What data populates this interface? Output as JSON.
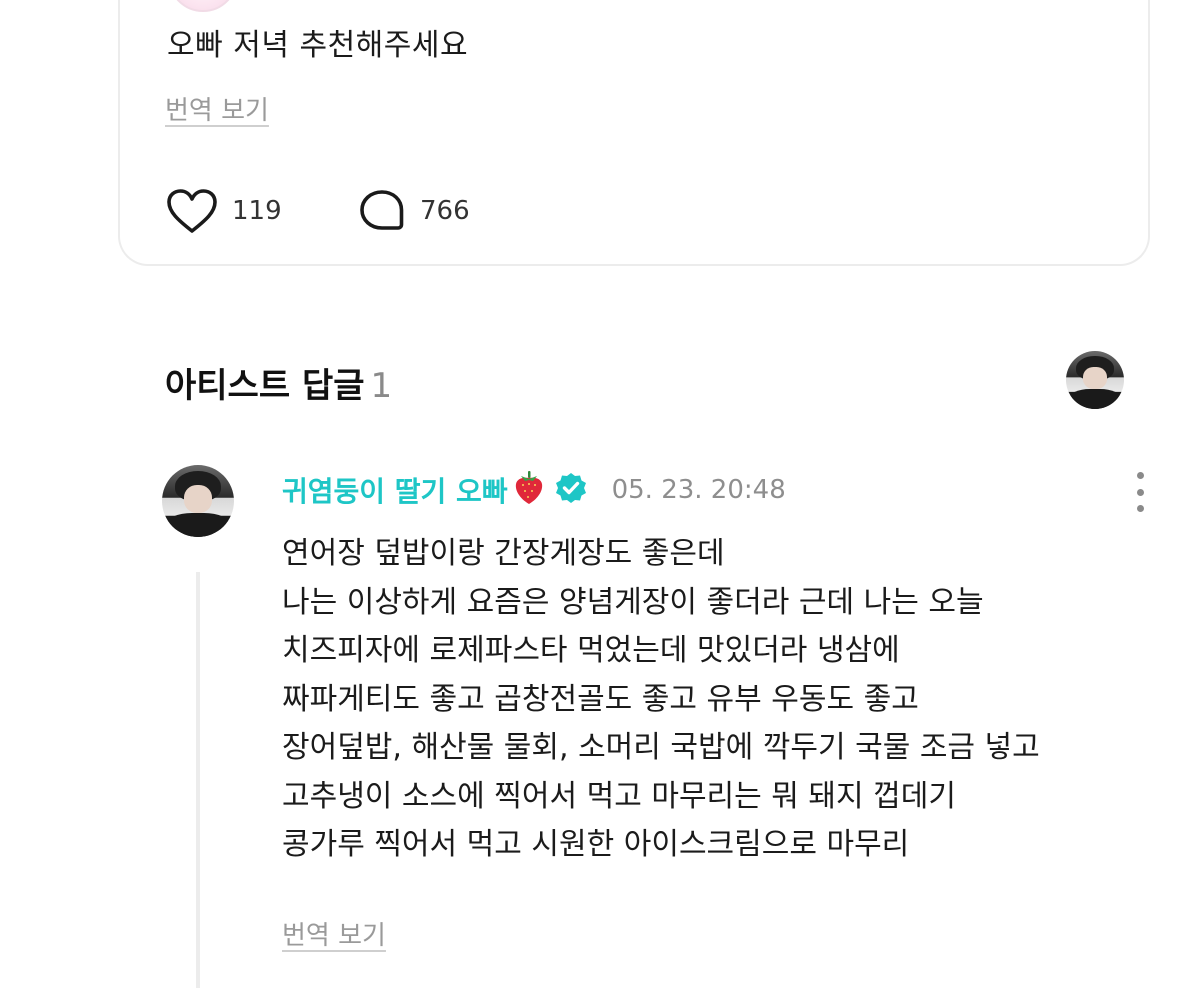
{
  "post": {
    "text": "오빠 저녁 추천해주세요",
    "translate_label": "번역 보기",
    "likes": "119",
    "comments": "766",
    "icons": {
      "like": "heart-outline-icon",
      "comment": "speech-bubble-icon"
    }
  },
  "artist_replies": {
    "title": "아티스트 답글",
    "count": "1"
  },
  "reply": {
    "author": "귀염둥이 딸기 오빠",
    "timestamp": "05. 23. 20:48",
    "lines": [
      "연어장 덮밥이랑 간장게장도 좋은데",
      "나는 이상하게 요즘은 양념게장이 좋더라 근데 나는 오늘",
      "치즈피자에 로제파스타 먹었는데 맛있더라 냉삼에",
      "짜파게티도 좋고 곱창전골도 좋고 유부 우동도 좋고",
      "장어덮밥, 해산물 물회, 소머리 국밥에 깍두기 국물 조금 넣고",
      "고추냉이 소스에 찍어서 먹고 마무리는 뭐 돼지 껍데기",
      "콩가루 찍어서 먹고 시원한 아이스크림으로 마무리"
    ],
    "translate_label": "번역 보기",
    "icons": {
      "author_emoji": "strawberry-icon",
      "badge": "verified-badge-icon",
      "menu": "more-vertical-icon"
    }
  },
  "colors": {
    "artist_name": "#1ec6c6",
    "verified_badge": "#1ec6c6",
    "muted_text": "#9a9a9a",
    "card_border": "#ececec"
  }
}
